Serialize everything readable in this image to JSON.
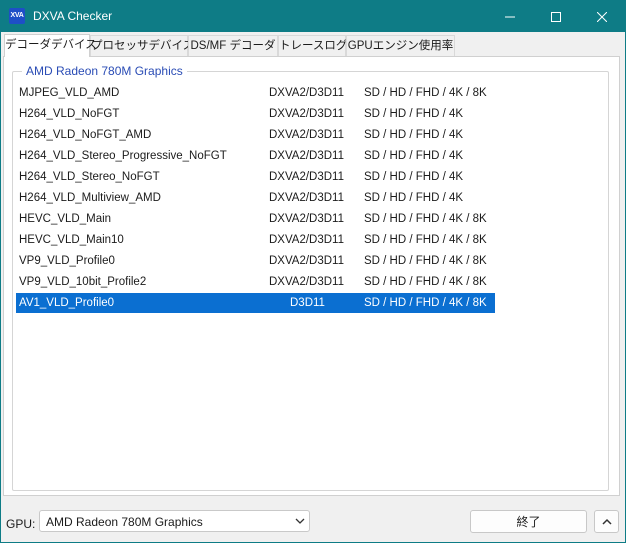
{
  "window": {
    "app_icon_text": "XVA",
    "title": "DXVA Checker"
  },
  "tabs": [
    {
      "label": "デコーダデバイス",
      "active": true
    },
    {
      "label": "プロセッサデバイス",
      "active": false
    },
    {
      "label": "DS/MF デコーダ",
      "active": false
    },
    {
      "label": "トレースログ",
      "active": false
    },
    {
      "label": "GPUエンジン使用率",
      "active": false
    }
  ],
  "group": {
    "title": "AMD Radeon 780M Graphics"
  },
  "decoders": [
    {
      "name": "MJPEG_VLD_AMD",
      "api": "DXVA2/D3D11",
      "resolutions": "SD / HD / FHD / 4K / 8K"
    },
    {
      "name": "H264_VLD_NoFGT",
      "api": "DXVA2/D3D11",
      "resolutions": "SD / HD / FHD / 4K"
    },
    {
      "name": "H264_VLD_NoFGT_AMD",
      "api": "DXVA2/D3D11",
      "resolutions": "SD / HD / FHD / 4K"
    },
    {
      "name": "H264_VLD_Stereo_Progressive_NoFGT",
      "api": "DXVA2/D3D11",
      "resolutions": "SD / HD / FHD / 4K"
    },
    {
      "name": "H264_VLD_Stereo_NoFGT",
      "api": "DXVA2/D3D11",
      "resolutions": "SD / HD / FHD / 4K"
    },
    {
      "name": "H264_VLD_Multiview_AMD",
      "api": "DXVA2/D3D11",
      "resolutions": "SD / HD / FHD / 4K"
    },
    {
      "name": "HEVC_VLD_Main",
      "api": "DXVA2/D3D11",
      "resolutions": "SD / HD / FHD / 4K / 8K"
    },
    {
      "name": "HEVC_VLD_Main10",
      "api": "DXVA2/D3D11",
      "resolutions": "SD / HD / FHD / 4K / 8K"
    },
    {
      "name": "VP9_VLD_Profile0",
      "api": "DXVA2/D3D11",
      "resolutions": "SD / HD / FHD / 4K / 8K"
    },
    {
      "name": "VP9_VLD_10bit_Profile2",
      "api": "DXVA2/D3D11",
      "resolutions": "SD / HD / FHD / 4K / 8K"
    },
    {
      "name": "AV1_VLD_Profile0",
      "api": "D3D11",
      "resolutions": "SD / HD / FHD / 4K / 8K",
      "selected": true
    }
  ],
  "statusbar": {
    "gpu_label": "GPU:",
    "gpu_selected": "AMD Radeon 780M Graphics",
    "quit_label": "終了"
  },
  "colors": {
    "titlebar": "#0e7c86",
    "selection": "#0b6fd1",
    "group_title": "#2a4cb5"
  },
  "icons": {
    "minimize": "minimize-icon",
    "maximize": "maximize-icon",
    "close": "close-icon",
    "dropdown": "chevron-down-icon",
    "collapse": "chevron-up-icon"
  }
}
